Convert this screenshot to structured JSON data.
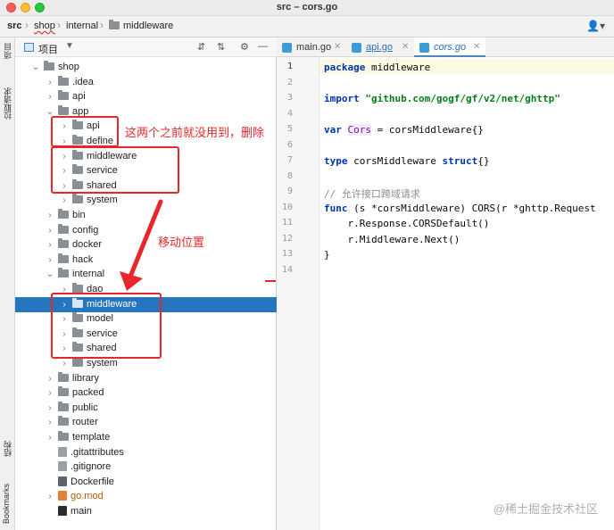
{
  "window": {
    "title": "src – cors.go",
    "breadcrumb": [
      "src",
      "shop",
      "internal",
      "middleware"
    ]
  },
  "toolstrip": {
    "left_items": [
      "项目",
      "拉取请求",
      "结构",
      "Bookmarks"
    ]
  },
  "project": {
    "header_title": "项目",
    "tree": [
      {
        "label": "shop",
        "type": "folder",
        "depth": 1,
        "expanded": true
      },
      {
        "label": ".idea",
        "type": "folder",
        "depth": 2,
        "expanded": false
      },
      {
        "label": "api",
        "type": "folder",
        "depth": 2,
        "expanded": false
      },
      {
        "label": "app",
        "type": "folder",
        "depth": 2,
        "expanded": true
      },
      {
        "label": "api",
        "type": "folder",
        "depth": 3,
        "expanded": false
      },
      {
        "label": "define",
        "type": "folder",
        "depth": 3,
        "expanded": false
      },
      {
        "label": "middleware",
        "type": "folder",
        "depth": 3,
        "expanded": false
      },
      {
        "label": "service",
        "type": "folder",
        "depth": 3,
        "expanded": false
      },
      {
        "label": "shared",
        "type": "folder",
        "depth": 3,
        "expanded": false
      },
      {
        "label": "system",
        "type": "folder",
        "depth": 3,
        "expanded": false
      },
      {
        "label": "bin",
        "type": "folder",
        "depth": 2,
        "expanded": false
      },
      {
        "label": "config",
        "type": "folder",
        "depth": 2,
        "expanded": false
      },
      {
        "label": "docker",
        "type": "folder",
        "depth": 2,
        "expanded": false
      },
      {
        "label": "hack",
        "type": "folder",
        "depth": 2,
        "expanded": false
      },
      {
        "label": "internal",
        "type": "folder",
        "depth": 2,
        "expanded": true
      },
      {
        "label": "dao",
        "type": "folder",
        "depth": 3,
        "expanded": false
      },
      {
        "label": "middleware",
        "type": "folder",
        "depth": 3,
        "expanded": false,
        "selected": true
      },
      {
        "label": "model",
        "type": "folder",
        "depth": 3,
        "expanded": false
      },
      {
        "label": "service",
        "type": "folder",
        "depth": 3,
        "expanded": false
      },
      {
        "label": "shared",
        "type": "folder",
        "depth": 3,
        "expanded": false
      },
      {
        "label": "system",
        "type": "folder",
        "depth": 3,
        "expanded": false
      },
      {
        "label": "library",
        "type": "folder",
        "depth": 2,
        "expanded": false
      },
      {
        "label": "packed",
        "type": "folder",
        "depth": 2,
        "expanded": false
      },
      {
        "label": "public",
        "type": "folder",
        "depth": 2,
        "expanded": false
      },
      {
        "label": "router",
        "type": "folder",
        "depth": 2,
        "expanded": false
      },
      {
        "label": "template",
        "type": "folder",
        "depth": 2,
        "expanded": false
      },
      {
        "label": ".gitattributes",
        "type": "git",
        "depth": 2
      },
      {
        "label": ".gitignore",
        "type": "git",
        "depth": 2
      },
      {
        "label": "Dockerfile",
        "type": "doc",
        "depth": 2
      },
      {
        "label": "go.mod",
        "type": "mod",
        "depth": 2,
        "expanded": false
      },
      {
        "label": "main",
        "type": "bin",
        "depth": 2
      }
    ]
  },
  "annotations": {
    "note_remove": "这两个之前就没用到，删除",
    "note_move": "移动位置"
  },
  "editor": {
    "tabs": [
      {
        "label": "main.go",
        "active": false
      },
      {
        "label": "api.go",
        "active": false
      },
      {
        "label": "cors.go",
        "active": true
      }
    ],
    "line_numbers": [
      "1",
      "2",
      "3",
      "4",
      "5",
      "6",
      "7",
      "8",
      "9",
      "10",
      "11",
      "12",
      "13",
      "14"
    ],
    "current_line": 1,
    "code_lines": [
      "package middleware",
      "",
      "import \"github.com/gogf/gf/v2/net/ghttp\"",
      "",
      "var Cors = corsMiddleware{}",
      "",
      "type corsMiddleware struct{}",
      "",
      "// 允许接口跨域请求",
      "func (s *corsMiddleware) CORS(r *ghttp.Request",
      "    r.Response.CORSDefault()",
      "    r.Middleware.Next()",
      "}",
      ""
    ]
  },
  "watermark": "@稀土掘金技术社区",
  "colors": {
    "selection": "#2675bf",
    "annotation": "#e8262b",
    "keyword": "#0033b3",
    "string": "#067d17",
    "comment": "#8c8c8c"
  }
}
